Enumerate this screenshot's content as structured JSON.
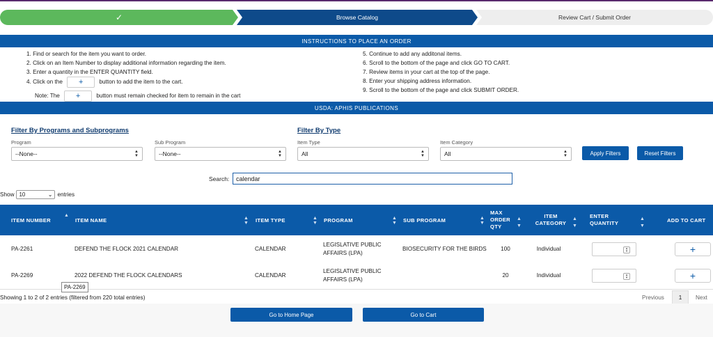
{
  "steps": {
    "step1_icon": "check-icon",
    "step2_label": "Browse Catalog",
    "step3_label": "Review Cart / Submit Order"
  },
  "instructions": {
    "title": "INSTRUCTIONS TO PLACE AN ORDER",
    "left": [
      "1. Find or search for the item you want to order.",
      "2. Click on an Item Number to display additional information regarding the item.",
      "3. Enter a quantity in the ENTER QUANTITY field.",
      "4. Click on the",
      "button to add the item to the cart."
    ],
    "note_prefix": "Note: The",
    "note_suffix": "button must remain checked for item to remain in the cart",
    "right": [
      "5. Continue to add any additonal items.",
      "6. Scroll to the bottom of the page and click GO TO CART.",
      "7. Review items in your cart at the top of the page.",
      "8. Enter your shipping address information.",
      "9. Scroll to the bottom of the page and click SUBMIT ORDER."
    ]
  },
  "section_title": "USDA: APHIS PUBLICATIONS",
  "filters": {
    "programs_title": "Filter By Programs and Subprograms",
    "type_title": "Filter By Type",
    "program_label": "Program",
    "program_value": "--None--",
    "subprogram_label": "Sub Program",
    "subprogram_value": "--None--",
    "itemtype_label": "Item Type",
    "itemtype_value": "All",
    "itemcategory_label": "Item Category",
    "itemcategory_value": "All",
    "apply_label": "Apply Filters",
    "reset_label": "Reset Filters"
  },
  "search": {
    "label": "Search:",
    "value": "calendar"
  },
  "length": {
    "prefix": "Show",
    "value": "10",
    "suffix": "entries"
  },
  "table": {
    "headers": {
      "item_number": "ITEM NUMBER",
      "item_name": "ITEM NAME",
      "item_type": "ITEM TYPE",
      "program": "PROGRAM",
      "sub_program": "SUB PROGRAM",
      "max_order_qty": "MAX ORDER QTY",
      "item_category": "ITEM CATEGORY",
      "enter_quantity": "ENTER QUANTITY",
      "add_to_cart": "ADD TO CART"
    },
    "rows": [
      {
        "item_number": "PA-2261",
        "item_name": "DEFEND THE FLOCK 2021 CALENDAR",
        "item_type": "CALENDAR",
        "program": "LEGISLATIVE PUBLIC AFFAIRS (LPA)",
        "sub_program": "BIOSECURITY FOR THE BIRDS",
        "max_order_qty": "100",
        "item_category": "Individual"
      },
      {
        "item_number": "PA-2269",
        "item_name": "2022 DEFEND THE FLOCK CALENDARS",
        "item_type": "CALENDAR",
        "program": "LEGISLATIVE PUBLIC AFFAIRS (LPA)",
        "sub_program": "",
        "max_order_qty": "20",
        "item_category": "Individual"
      }
    ]
  },
  "tooltip": "PA-2269",
  "info": "Showing 1 to 2 of 2 entries (filtered from 220 total entries)",
  "pagination": {
    "previous": "Previous",
    "page": "1",
    "next": "Next"
  },
  "actions": {
    "home_label": "Go to Home Page",
    "cart_label": "Go to Cart"
  },
  "colors": {
    "primary": "#0b5aa8",
    "progress_done": "#5cb85c",
    "progress_active": "#0e4a8a"
  }
}
